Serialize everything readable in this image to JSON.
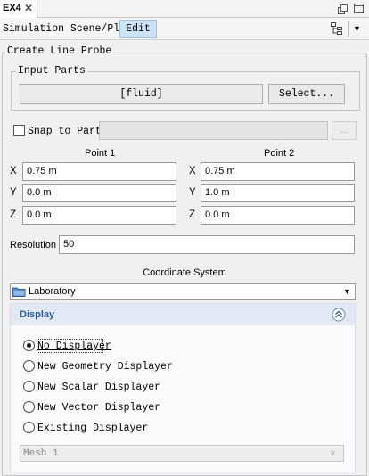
{
  "tab": {
    "title": "EX4",
    "close": "✕"
  },
  "toolbar": {
    "simulation_tab": "Simulation Scene/Plot",
    "edit_tab": "Edit",
    "dropdown_glyph": "▼"
  },
  "probe": {
    "title": "Create Line Probe",
    "input_parts": {
      "title": "Input Parts",
      "value": "[fluid]",
      "select_label": "Select..."
    },
    "snap": {
      "label": "Snap to Part",
      "checked": false,
      "value": "",
      "button_label": "..."
    },
    "point1": {
      "label": "Point 1",
      "x": "0.75 m",
      "y": "0.0 m",
      "z": "0.0 m"
    },
    "point2": {
      "label": "Point 2",
      "x": "0.75 m",
      "y": "1.0 m",
      "z": "0.0 m"
    },
    "axes": {
      "x": "X",
      "y": "Y",
      "z": "Z"
    },
    "resolution": {
      "label": "Resolution",
      "value": "50"
    },
    "coordinate_system": {
      "label": "Coordinate System",
      "value": "Laboratory",
      "arrow": "▼"
    }
  },
  "display": {
    "title": "Display",
    "options": [
      {
        "label": "No Displayer",
        "selected": true
      },
      {
        "label": "New Geometry Displayer",
        "selected": false
      },
      {
        "label": "New Scalar Displayer",
        "selected": false
      },
      {
        "label": "New Vector Displayer",
        "selected": false
      },
      {
        "label": "Existing Displayer",
        "selected": false
      }
    ],
    "existing_value": "Mesh 1",
    "existing_arrow": "∨"
  },
  "colors": {
    "accent": "#2c5aa0",
    "header_bg": "#e3e9f4",
    "edit_tab_bg": "#cde3f7"
  }
}
